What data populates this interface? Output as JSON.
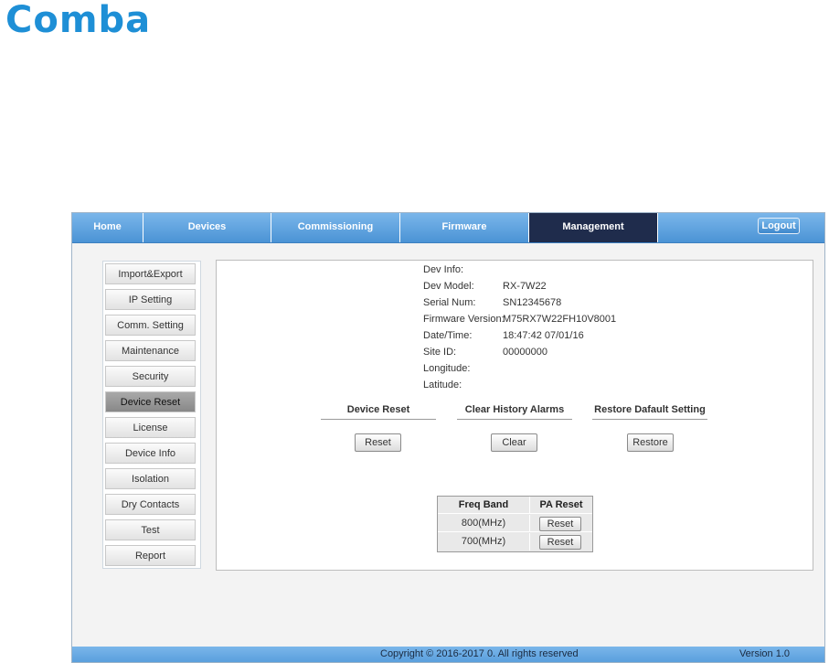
{
  "brand": {
    "logo_text": "Comba"
  },
  "nav": {
    "items": [
      "Home",
      "Devices",
      "Commissioning",
      "Firmware",
      "Management"
    ],
    "active": "Management",
    "logout_label": "Logout"
  },
  "sidebar": {
    "items": [
      "Import&Export",
      "IP Setting",
      "Comm. Setting",
      "Maintenance",
      "Security",
      "Device Reset",
      "License",
      "Device Info",
      "Isolation",
      "Dry Contacts",
      "Test",
      "Report"
    ],
    "active": "Device Reset"
  },
  "dev_info": {
    "header": "Dev Info:",
    "rows": [
      {
        "label": "Dev Model:",
        "value": "RX-7W22"
      },
      {
        "label": "Serial Num:",
        "value": "SN12345678"
      },
      {
        "label": "Firmware Version:",
        "value": "M75RX7W22FH10V8001"
      },
      {
        "label": "Date/Time:",
        "value": "18:47:42 07/01/16"
      },
      {
        "label": "Site ID:",
        "value": "00000000"
      },
      {
        "label": "Longitude:",
        "value": ""
      },
      {
        "label": "Latitude:",
        "value": ""
      }
    ]
  },
  "sections": {
    "reset": {
      "title": "Device Reset",
      "button": "Reset"
    },
    "clear": {
      "title": "Clear History Alarms",
      "button": "Clear"
    },
    "restore": {
      "title": "Restore Dafault Setting",
      "button": "Restore"
    }
  },
  "pa_table": {
    "headers": [
      "Freq Band",
      "PA Reset"
    ],
    "rows": [
      {
        "band": "800(MHz)",
        "button": "Reset"
      },
      {
        "band": "700(MHz)",
        "button": "Reset"
      }
    ]
  },
  "footer": {
    "copyright": "Copyright © 2016-2017 0. All rights reserved",
    "version": "Version 1.0"
  },
  "colors": {
    "brand": "#1e8fd6",
    "nav_bar": "#5aa0dd",
    "nav_active": "#1f2c4c",
    "sidebar_active": "#9a9a9a"
  }
}
